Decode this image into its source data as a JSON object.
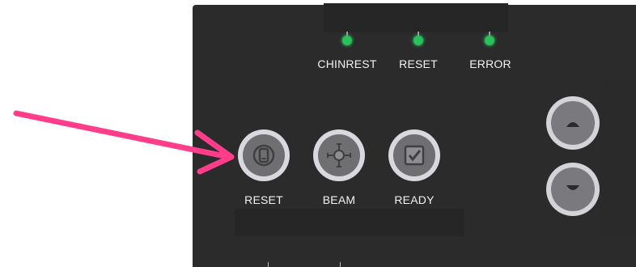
{
  "indicators": [
    {
      "label": "CHINREST",
      "color": "#27c05a"
    },
    {
      "label": "RESET",
      "color": "#27c05a"
    },
    {
      "label": "ERROR",
      "color": "#27c05a"
    }
  ],
  "buttons": [
    {
      "label": "RESET",
      "icon": "reset-icon"
    },
    {
      "label": "BEAM",
      "icon": "beam-icon"
    },
    {
      "label": "READY",
      "icon": "checkbox-icon"
    }
  ],
  "side_buttons": [
    {
      "icon": "chevron-up-icon"
    },
    {
      "icon": "chevron-down-icon"
    }
  ],
  "annotation": {
    "color": "#ff3d8b"
  },
  "theme": {
    "panel": "#2b2b2b",
    "button_ring": "#d8d8de",
    "button_fill": "#6f6f72"
  }
}
